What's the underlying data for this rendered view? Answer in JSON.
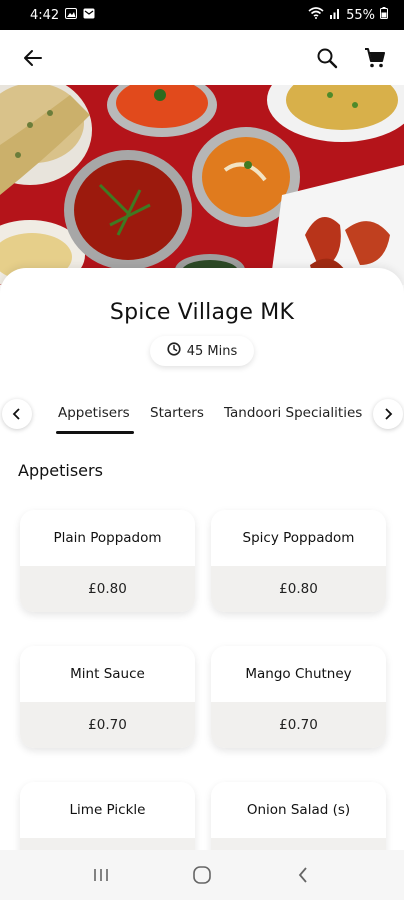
{
  "status_bar": {
    "time": "4:42",
    "battery": "55%",
    "icons": [
      "gallery-icon",
      "message-icon",
      "wifi-icon",
      "signal-icon",
      "battery-icon"
    ]
  },
  "app_bar": {
    "icons": [
      "back-arrow-icon",
      "search-icon",
      "cart-icon"
    ]
  },
  "restaurant": {
    "name": "Spice Village MK",
    "delivery_time": "45 Mins"
  },
  "tabs": [
    {
      "label": "Appetisers",
      "active": true
    },
    {
      "label": "Starters",
      "active": false
    },
    {
      "label": "Tandoori Specialities",
      "active": false
    }
  ],
  "section": {
    "title": "Appetisers"
  },
  "items": [
    {
      "name": "Plain Poppadom",
      "price": "£0.80"
    },
    {
      "name": "Spicy Poppadom",
      "price": "£0.80"
    },
    {
      "name": "Mint Sauce",
      "price": "£0.70"
    },
    {
      "name": "Mango Chutney",
      "price": "£0.70"
    },
    {
      "name": "Lime Pickle",
      "price": ""
    },
    {
      "name": "Onion Salad (s)",
      "price": ""
    }
  ],
  "colors": {
    "accent": "#111111",
    "price_bg": "#f1f0ee",
    "hero_bg": "#b4141a"
  }
}
